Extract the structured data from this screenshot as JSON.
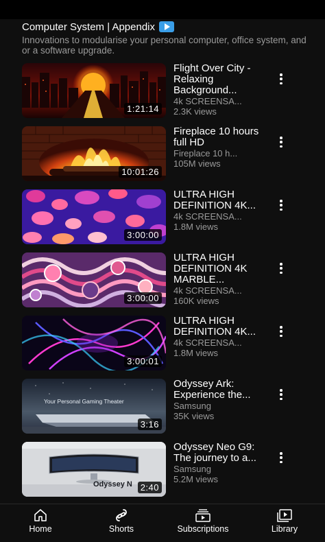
{
  "section": {
    "title": "Computer System | Appendix",
    "description": "Innovations to modularise your personal computer, office system, and or a software upgrade."
  },
  "videos": [
    {
      "title": "Flight Over City - Relaxing Background...",
      "channel": "4k SCREENSA...",
      "views": "2.3K views",
      "duration": "1:21:14"
    },
    {
      "title": "Fireplace 10 hours full HD",
      "channel": "Fireplace 10 h...",
      "views": "105M views",
      "duration": "10:01:26"
    },
    {
      "title": "ULTRA HIGH DEFINITION 4K...",
      "channel": "4k SCREENSA...",
      "views": "1.8M views",
      "duration": "3:00:00"
    },
    {
      "title": "ULTRA HIGH DEFINITION 4K MARBLE...",
      "channel": "4k SCREENSA...",
      "views": "160K views",
      "duration": "3:00:00"
    },
    {
      "title": "ULTRA HIGH DEFINITION 4K...",
      "channel": "4k SCREENSA...",
      "views": "1.8M views",
      "duration": "3:00:01"
    },
    {
      "title": "Odyssey Ark: Experience the...",
      "channel": "Samsung",
      "views": "35K views",
      "duration": "3:16",
      "thumb_text": "Your Personal Gaming Theater"
    },
    {
      "title": "Odyssey Neo G9: The journey to a...",
      "channel": "Samsung",
      "views": "5.2M views",
      "duration": "2:40",
      "thumb_text": "Odyssey N"
    }
  ],
  "nav": {
    "home": "Home",
    "shorts": "Shorts",
    "subscriptions": "Subscriptions",
    "library": "Library"
  },
  "colors": {
    "background": "#0f0f0f",
    "secondary_text": "#9a9a9a",
    "badge_blue": "#3a9ee8"
  }
}
